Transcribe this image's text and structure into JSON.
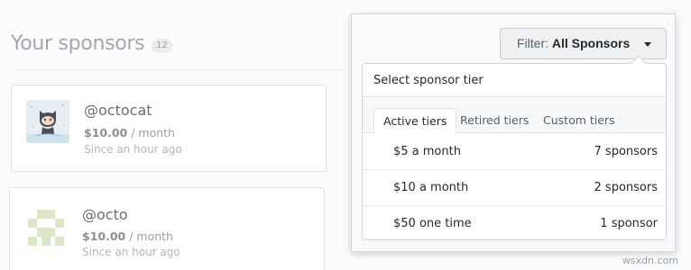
{
  "page": {
    "title": "Your sponsors",
    "count": "12"
  },
  "sponsors": [
    {
      "name": "@octocat",
      "amount": "$10.00",
      "period": " / month",
      "since": "Since an hour ago"
    },
    {
      "name": "@octo",
      "amount": "$10.00",
      "period": " / month",
      "since": "Since an hour ago"
    }
  ],
  "filter": {
    "prefix": "Filter:",
    "value": "All Sponsors",
    "menu_title": "Select sponsor tier",
    "tabs": [
      "Active tiers",
      "Retired tiers",
      "Custom tiers"
    ],
    "active_tab": "Active tiers",
    "tiers": [
      {
        "label": "$5 a month",
        "count": "7 sponsors"
      },
      {
        "label": "$10 a month",
        "count": "2 sponsors"
      },
      {
        "label": "$50 one time",
        "count": "1 sponsor"
      }
    ]
  },
  "watermark": "wsxdn.com",
  "icons": {
    "filter_caret": "caret-down-icon",
    "avatar_1": "octocat-avatar",
    "avatar_2": "identicon-avatar"
  }
}
